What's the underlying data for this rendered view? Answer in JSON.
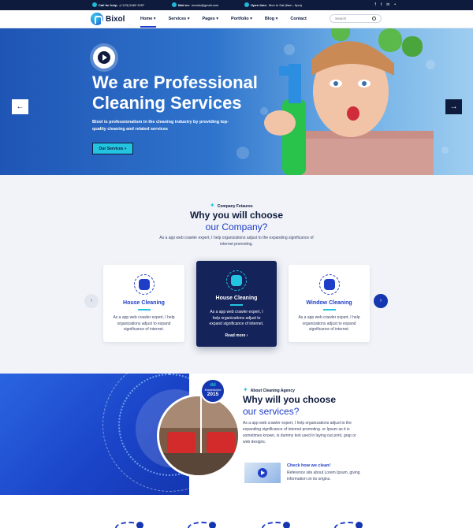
{
  "topbar": {
    "help_label": "Call for help:",
    "help_value": "(+123) 5462 3257",
    "mail_label": "Mail us:",
    "mail_value": "envato@gmail.com",
    "open_label": "Open time:",
    "open_value": "Mon to Sat (8am - 6pm)",
    "social": [
      "f",
      "t",
      "in",
      "•"
    ]
  },
  "nav": {
    "logo": "Bixol",
    "menu": [
      {
        "label": "Home ▾",
        "active": true
      },
      {
        "label": "Services ▾",
        "active": false
      },
      {
        "label": "Pages ▾",
        "active": false
      },
      {
        "label": "Portfolio ▾",
        "active": false
      },
      {
        "label": "Blog ▾",
        "active": false
      },
      {
        "label": "Contact",
        "active": false
      }
    ],
    "search_placeholder": "Search"
  },
  "hero": {
    "title_line1": "We are Professional",
    "title_line2": "Cleaning Services",
    "subtitle": "Bixol is professionalism in the cleaning industry by providing top-quality cleaning and related services",
    "button": "Our Services »",
    "prev": "←",
    "next": "→"
  },
  "features": {
    "eyebrow": "Company Fetaures",
    "title": "Why you will choose",
    "title2": "our Company?",
    "desc": "As a app web crawler expert, I help organizations adjust to the expanding significance of internet promoting.",
    "cards": [
      {
        "title": "House Cleaning",
        "desc": "As a app web crawler expert, I help organizations adjust to expand significance of internet."
      },
      {
        "title": "House Cleaning",
        "desc": "As a app web crawler expert, I help organizations adjust to expand significance of internet.",
        "more": "Read more ›"
      },
      {
        "title": "Window Cleaning",
        "desc": "As a app web crawler expert, I help organizations adjust to expand significance of internet."
      }
    ],
    "prev": "‹",
    "next": "›"
  },
  "about": {
    "badge_logo": "dd",
    "badge_label": "Established",
    "badge_year": "2015",
    "eyebrow": "About Cleaning Agency",
    "title": "Why will you choose",
    "title2": "our services?",
    "desc": "As a app web crawler expert, I help organizations adjust to the expanding significance of internet promoting.  or Ipsum as it is sometimes known, is dummy text used in laying out print, grap or web designs.",
    "check_title": "Check how we clean!",
    "check_desc": "Reference site about Lorem Ipsum, giving information on its origins."
  },
  "colors": {
    "navy": "#0e1b3d",
    "brand_blue": "#1e3ec7",
    "accent_cyan": "#22c4e0"
  }
}
